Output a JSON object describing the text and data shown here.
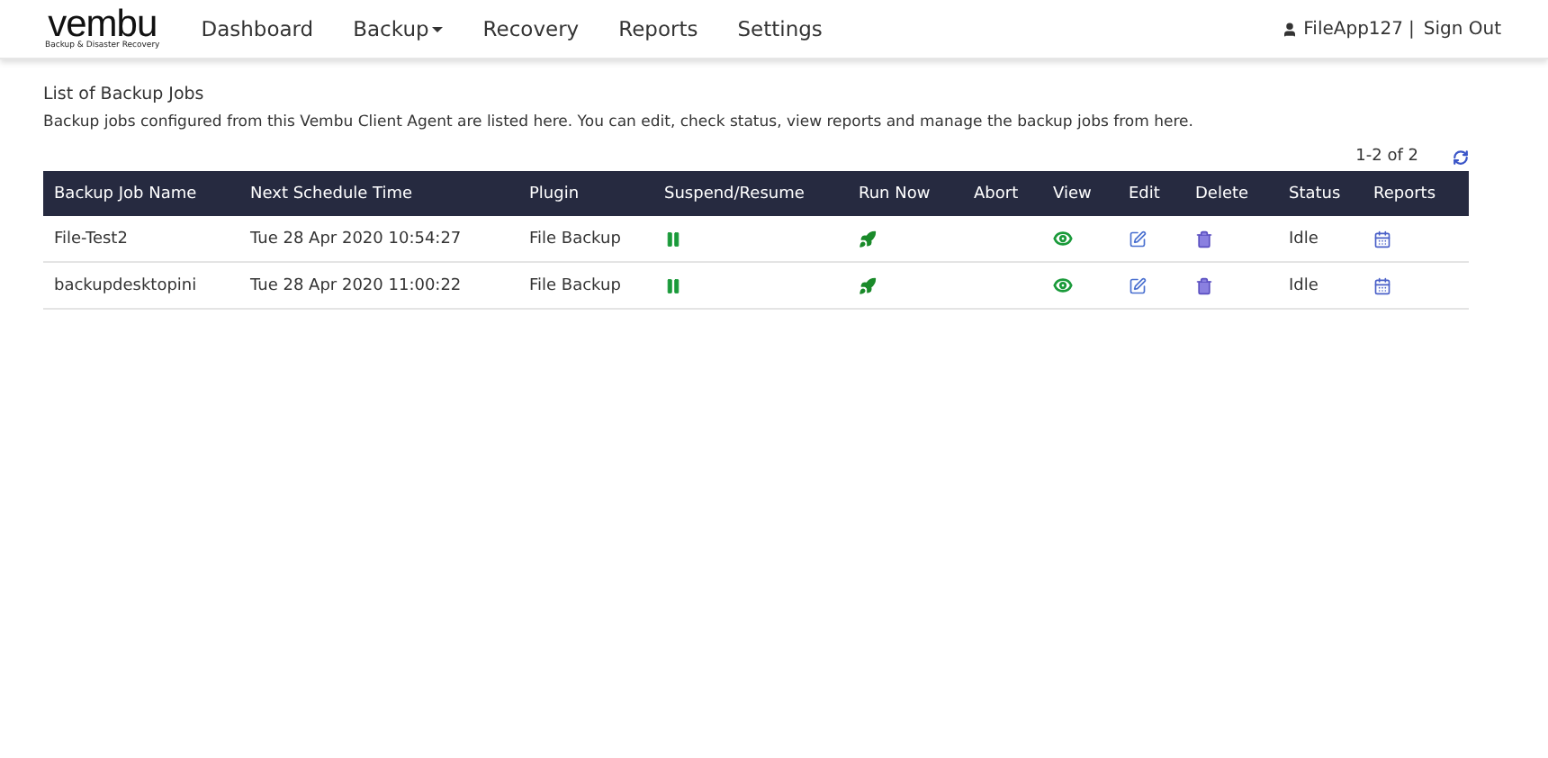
{
  "logo": {
    "name": "vembu",
    "tagline": "Backup & Disaster Recovery"
  },
  "nav": [
    {
      "label": "Dashboard",
      "kind": "link"
    },
    {
      "label": "Backup",
      "kind": "dropdown"
    },
    {
      "label": "Recovery",
      "kind": "link"
    },
    {
      "label": "Reports",
      "kind": "link"
    },
    {
      "label": "Settings",
      "kind": "link"
    }
  ],
  "user": {
    "name": "FileApp127",
    "separator": "|",
    "signout": "Sign Out"
  },
  "heading": "List of Backup Jobs",
  "description": "Backup jobs configured from this Vembu Client Agent are listed here. You can edit, check status, view reports and manage the backup jobs from here.",
  "pagination": "1-2 of 2",
  "table": {
    "columns": [
      "Backup Job Name",
      "Next Schedule Time",
      "Plugin",
      "Suspend/Resume",
      "Run Now",
      "Abort",
      "View",
      "Edit",
      "Delete",
      "Status",
      "Reports"
    ],
    "rows": [
      {
        "name": "File-Test2",
        "time": "Tue 28 Apr 2020 10:54:27",
        "plugin": "File Backup",
        "status": "Idle"
      },
      {
        "name": "backupdesktopini",
        "time": "Tue 28 Apr 2020 11:00:22",
        "plugin": "File Backup",
        "status": "Idle"
      }
    ]
  }
}
